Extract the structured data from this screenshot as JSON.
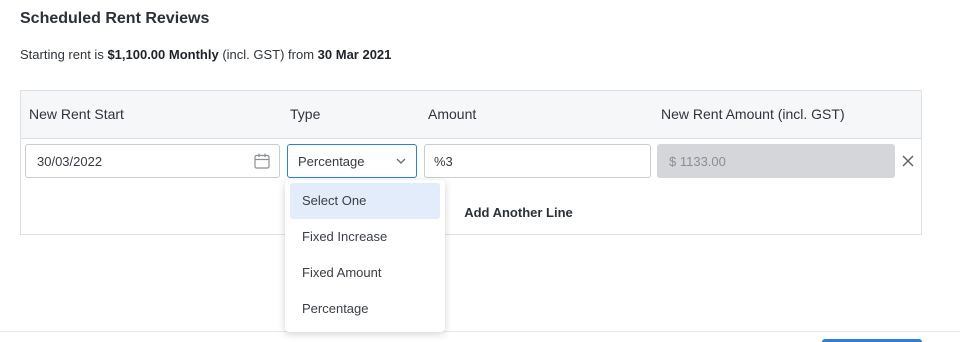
{
  "section": {
    "title": "Scheduled Rent Reviews"
  },
  "summary": {
    "prefix": "Starting rent is ",
    "amount": "$1,100.00 Monthly",
    "mid": " (incl. GST) from ",
    "date": "30 Mar 2021"
  },
  "table": {
    "headers": [
      "New Rent Start",
      "Type",
      "Amount",
      "New Rent Amount (incl. GST)"
    ],
    "row": {
      "start_date": "30/03/2022",
      "type": "Percentage",
      "amount": "%3",
      "new_rent": "$ 1133.00"
    },
    "add_line_label": "Add Another Line"
  },
  "dropdown": {
    "options": [
      "Select One",
      "Fixed Increase",
      "Fixed Amount",
      "Percentage"
    ],
    "highlighted": "Select One"
  },
  "colors": {
    "accent": "#2e7fd6",
    "highlight": "#e3ecfb",
    "disabled_bg": "#d4d6da"
  },
  "icons": {
    "date": "calendar-icon",
    "select": "chevron-down-icon",
    "remove": "close-icon"
  }
}
